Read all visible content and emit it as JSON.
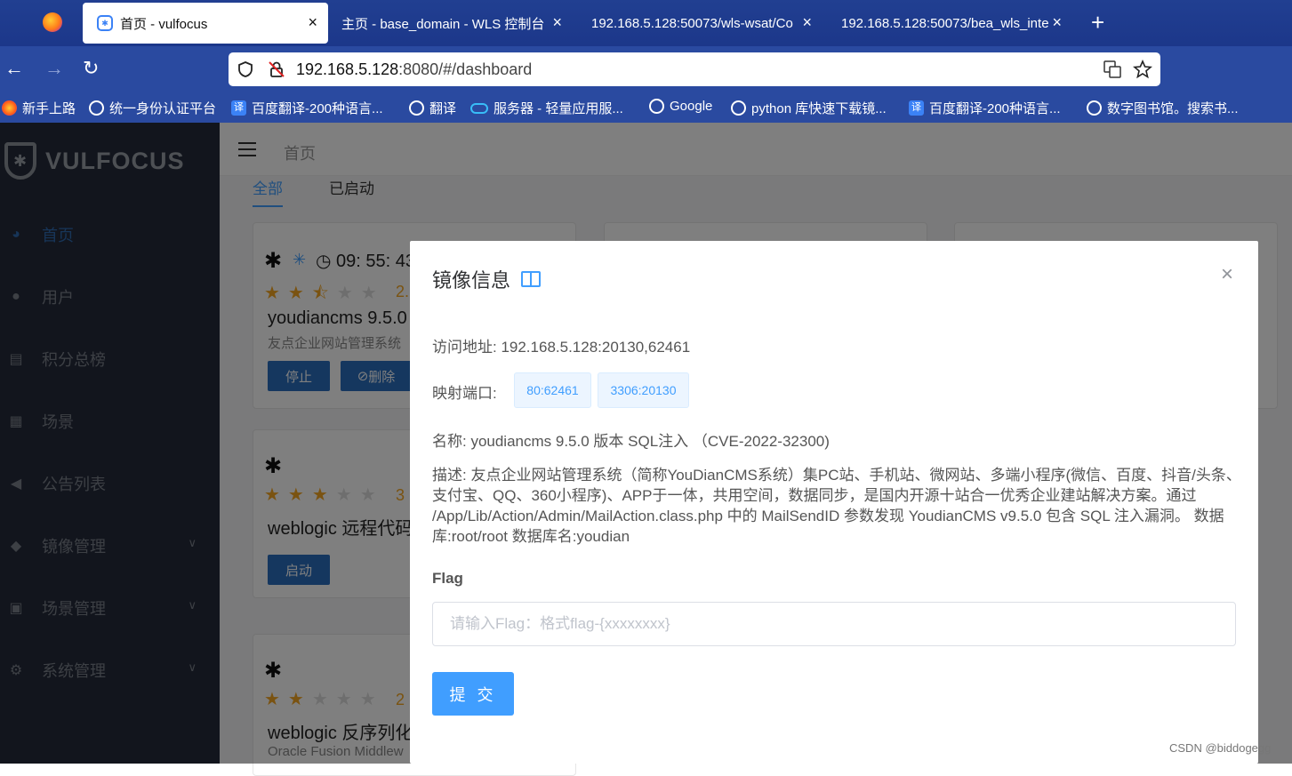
{
  "browser": {
    "tabs": [
      {
        "label": "首页 - vulfocus",
        "active": true
      },
      {
        "label": "主页 - base_domain - WLS 控制台",
        "active": false
      },
      {
        "label": "192.168.5.128:50073/wls-wsat/Co",
        "active": false
      },
      {
        "label": "192.168.5.128:50073/bea_wls_inte",
        "active": false
      }
    ],
    "close_glyph": "×",
    "new_tab_glyph": "+",
    "back_glyph": "←",
    "forward_glyph": "→",
    "reload_glyph": "↻",
    "url_host": "192.168.5.128",
    "url_rest": ":8080/#/dashboard",
    "bookmarks": [
      {
        "label": "新手上路",
        "icon": "firefox-icon"
      },
      {
        "label": "统一身份认证平台",
        "icon": "globe-icon"
      },
      {
        "label": "百度翻译-200种语言...",
        "icon": "translate-icon"
      },
      {
        "label": "翻译",
        "icon": "globe-icon"
      },
      {
        "label": "服务器 - 轻量应用服...",
        "icon": "cloud-icon"
      },
      {
        "label": "Google",
        "icon": "globe-icon"
      },
      {
        "label": "python 库快速下载镜...",
        "icon": "globe-icon"
      },
      {
        "label": "百度翻译-200种语言...",
        "icon": "translate-icon"
      },
      {
        "label": "数字图书馆。搜索书...",
        "icon": "globe-icon"
      }
    ]
  },
  "sidebar": {
    "logo_text": "VULFOCUS",
    "items": [
      {
        "label": "首页",
        "icon": "dashboard-icon",
        "active": true
      },
      {
        "label": "用户",
        "icon": "user-icon"
      },
      {
        "label": "积分总榜",
        "icon": "ranking-icon"
      },
      {
        "label": "场景",
        "icon": "grid-icon"
      },
      {
        "label": "公告列表",
        "icon": "megaphone-icon"
      },
      {
        "label": "镜像管理",
        "icon": "docker-icon",
        "expandable": true
      },
      {
        "label": "场景管理",
        "icon": "card-icon",
        "expandable": true
      },
      {
        "label": "系统管理",
        "icon": "gear-icon",
        "expandable": true
      }
    ]
  },
  "header": {
    "breadcrumb": "首页"
  },
  "filter_tabs": {
    "all": "全部",
    "running": "已启动"
  },
  "cards": [
    {
      "timer": "09: 55: 43",
      "rating": 2.5,
      "score": "2.",
      "title": "youdiancms 9.5.0",
      "subtitle": "友点企业网站管理系统",
      "stop_label": "停止",
      "delete_label": "删除"
    },
    {
      "rating": 3,
      "score": "3",
      "title": "weblogic 远程代码",
      "start_label": "启动"
    },
    {
      "rating": 2,
      "score": "2",
      "title": "weblogic 反序列化",
      "subtitle": "Oracle Fusion Middlew"
    }
  ],
  "modal": {
    "title": "镜像信息",
    "close_glyph": "×",
    "access_address": "访问地址: 192.168.5.128:20130,62461",
    "port_label": "映射端口:",
    "ports": [
      "80:62461",
      "3306:20130"
    ],
    "name": "名称: youdiancms 9.5.0 版本 SQL注入 （CVE-2022-32300)",
    "description": "描述: 友点企业网站管理系统（简称YouDianCMS系统）集PC站、手机站、微网站、多端小程序(微信、百度、抖音/头条、支付宝、QQ、360小程序)、APP于一体，共用空间，数据同步，是国内开源十站合一优秀企业建站解决方案。通过 /App/Lib/Action/Admin/MailAction.class.php 中的 MailSendID 参数发现 YoudianCMS v9.5.0 包含 SQL 注入漏洞。 数据库:root/root 数据库名:youdian",
    "flag_label": "Flag",
    "flag_placeholder": "请输入Flag：格式flag-{xxxxxxxx}",
    "flag_value": "",
    "submit_label": "提 交"
  },
  "watermark": "CSDN @biddogegg"
}
